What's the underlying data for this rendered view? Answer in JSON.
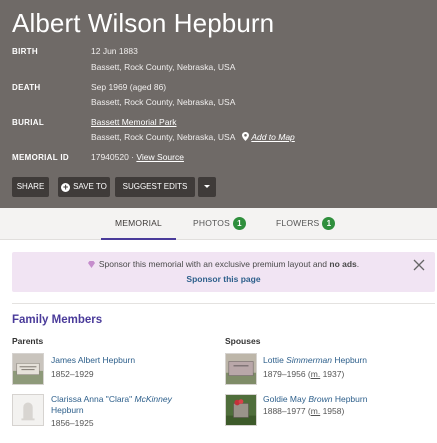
{
  "memorial": {
    "name": "Albert Wilson Hepburn",
    "birth_label": "BIRTH",
    "birth_date": "12 Jun 1883",
    "birth_place": "Bassett, Rock County, Nebraska, USA",
    "death_label": "DEATH",
    "death_date": "Sep 1969 (aged 86)",
    "death_place": "Bassett, Rock County, Nebraska, USA",
    "burial_label": "BURIAL",
    "burial_cemetery": "Bassett Memorial Park",
    "burial_place": "Bassett, Rock County, Nebraska, USA",
    "add_to_map": "Add to Map",
    "memorial_id_label": "MEMORIAL ID",
    "memorial_id": "17940520 ·",
    "view_source": "View Source"
  },
  "actions": {
    "share": "SHARE",
    "save_to": "SAVE TO",
    "suggest_edits": "SUGGEST EDITS"
  },
  "tabs": [
    {
      "label": "MEMORIAL"
    },
    {
      "label": "PHOTOS",
      "count": "1"
    },
    {
      "label": "FLOWERS",
      "count": "1"
    }
  ],
  "sponsor": {
    "text_part1": "Sponsor this memorial with an exclusive premium layout and",
    "text_bold": "no ads",
    "text_end": ".",
    "link": "Sponsor this page"
  },
  "family": {
    "title": "Family Members",
    "parents_label": "Parents",
    "spouses_label": "Spouses",
    "parents": [
      {
        "name": "James Albert Hepburn",
        "dates": "1852–1929"
      },
      {
        "name_part1": "Clarissa Anna \"Clara\"",
        "name_italic": "McKinney",
        "name_part2": "Hepburn",
        "dates": "1856–1925"
      }
    ],
    "spouses": [
      {
        "first": "Lottie",
        "maiden": "Simmerman",
        "last": "Hepburn",
        "dates": "1879–1956 (",
        "m": "m.",
        "m_year": " 1937)"
      },
      {
        "first": "Goldie May",
        "maiden": "Brown",
        "last": "Hepburn",
        "dates": "1888–1977 (",
        "m": "m.",
        "m_year": " 1958)"
      }
    ]
  },
  "colors": {
    "header_bg": "#6f6a67",
    "accent": "#4a3b9a",
    "link": "#2d5f8b",
    "badge": "#2f8f3d",
    "sponsor_bg": "#f1e4f3"
  }
}
